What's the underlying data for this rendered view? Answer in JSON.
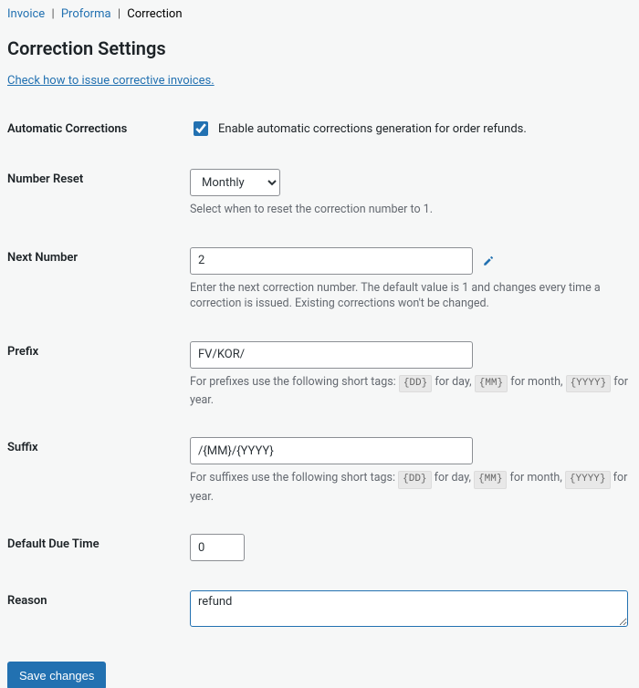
{
  "tabs": {
    "invoice": "Invoice",
    "proforma": "Proforma",
    "correction": "Correction"
  },
  "heading": "Correction Settings",
  "help_link": "Check how to issue corrective invoices.",
  "fields": {
    "auto": {
      "label": "Automatic Corrections",
      "text": "Enable automatic corrections generation for order refunds.",
      "checked": true
    },
    "reset": {
      "label": "Number Reset",
      "value": "Monthly",
      "desc": "Select when to reset the correction number to 1."
    },
    "next": {
      "label": "Next Number",
      "value": "2",
      "desc": "Enter the next correction number. The default value is 1 and changes every time a correction is issued. Existing corrections won't be changed."
    },
    "prefix": {
      "label": "Prefix",
      "value": "FV/KOR/",
      "desc_pre": "For prefixes use the following short tags:"
    },
    "suffix": {
      "label": "Suffix",
      "value": "/{MM}/{YYYY}",
      "desc_pre": "For suffixes use the following short tags:"
    },
    "tags": {
      "dd": "{DD}",
      "mm": "{MM}",
      "yyyy": "{YYYY}",
      "for_day": " for day, ",
      "for_month": " for month, ",
      "for_year": " for year."
    },
    "due": {
      "label": "Default Due Time",
      "value": "0"
    },
    "reason": {
      "label": "Reason",
      "value": "refund"
    }
  },
  "submit": "Save changes"
}
